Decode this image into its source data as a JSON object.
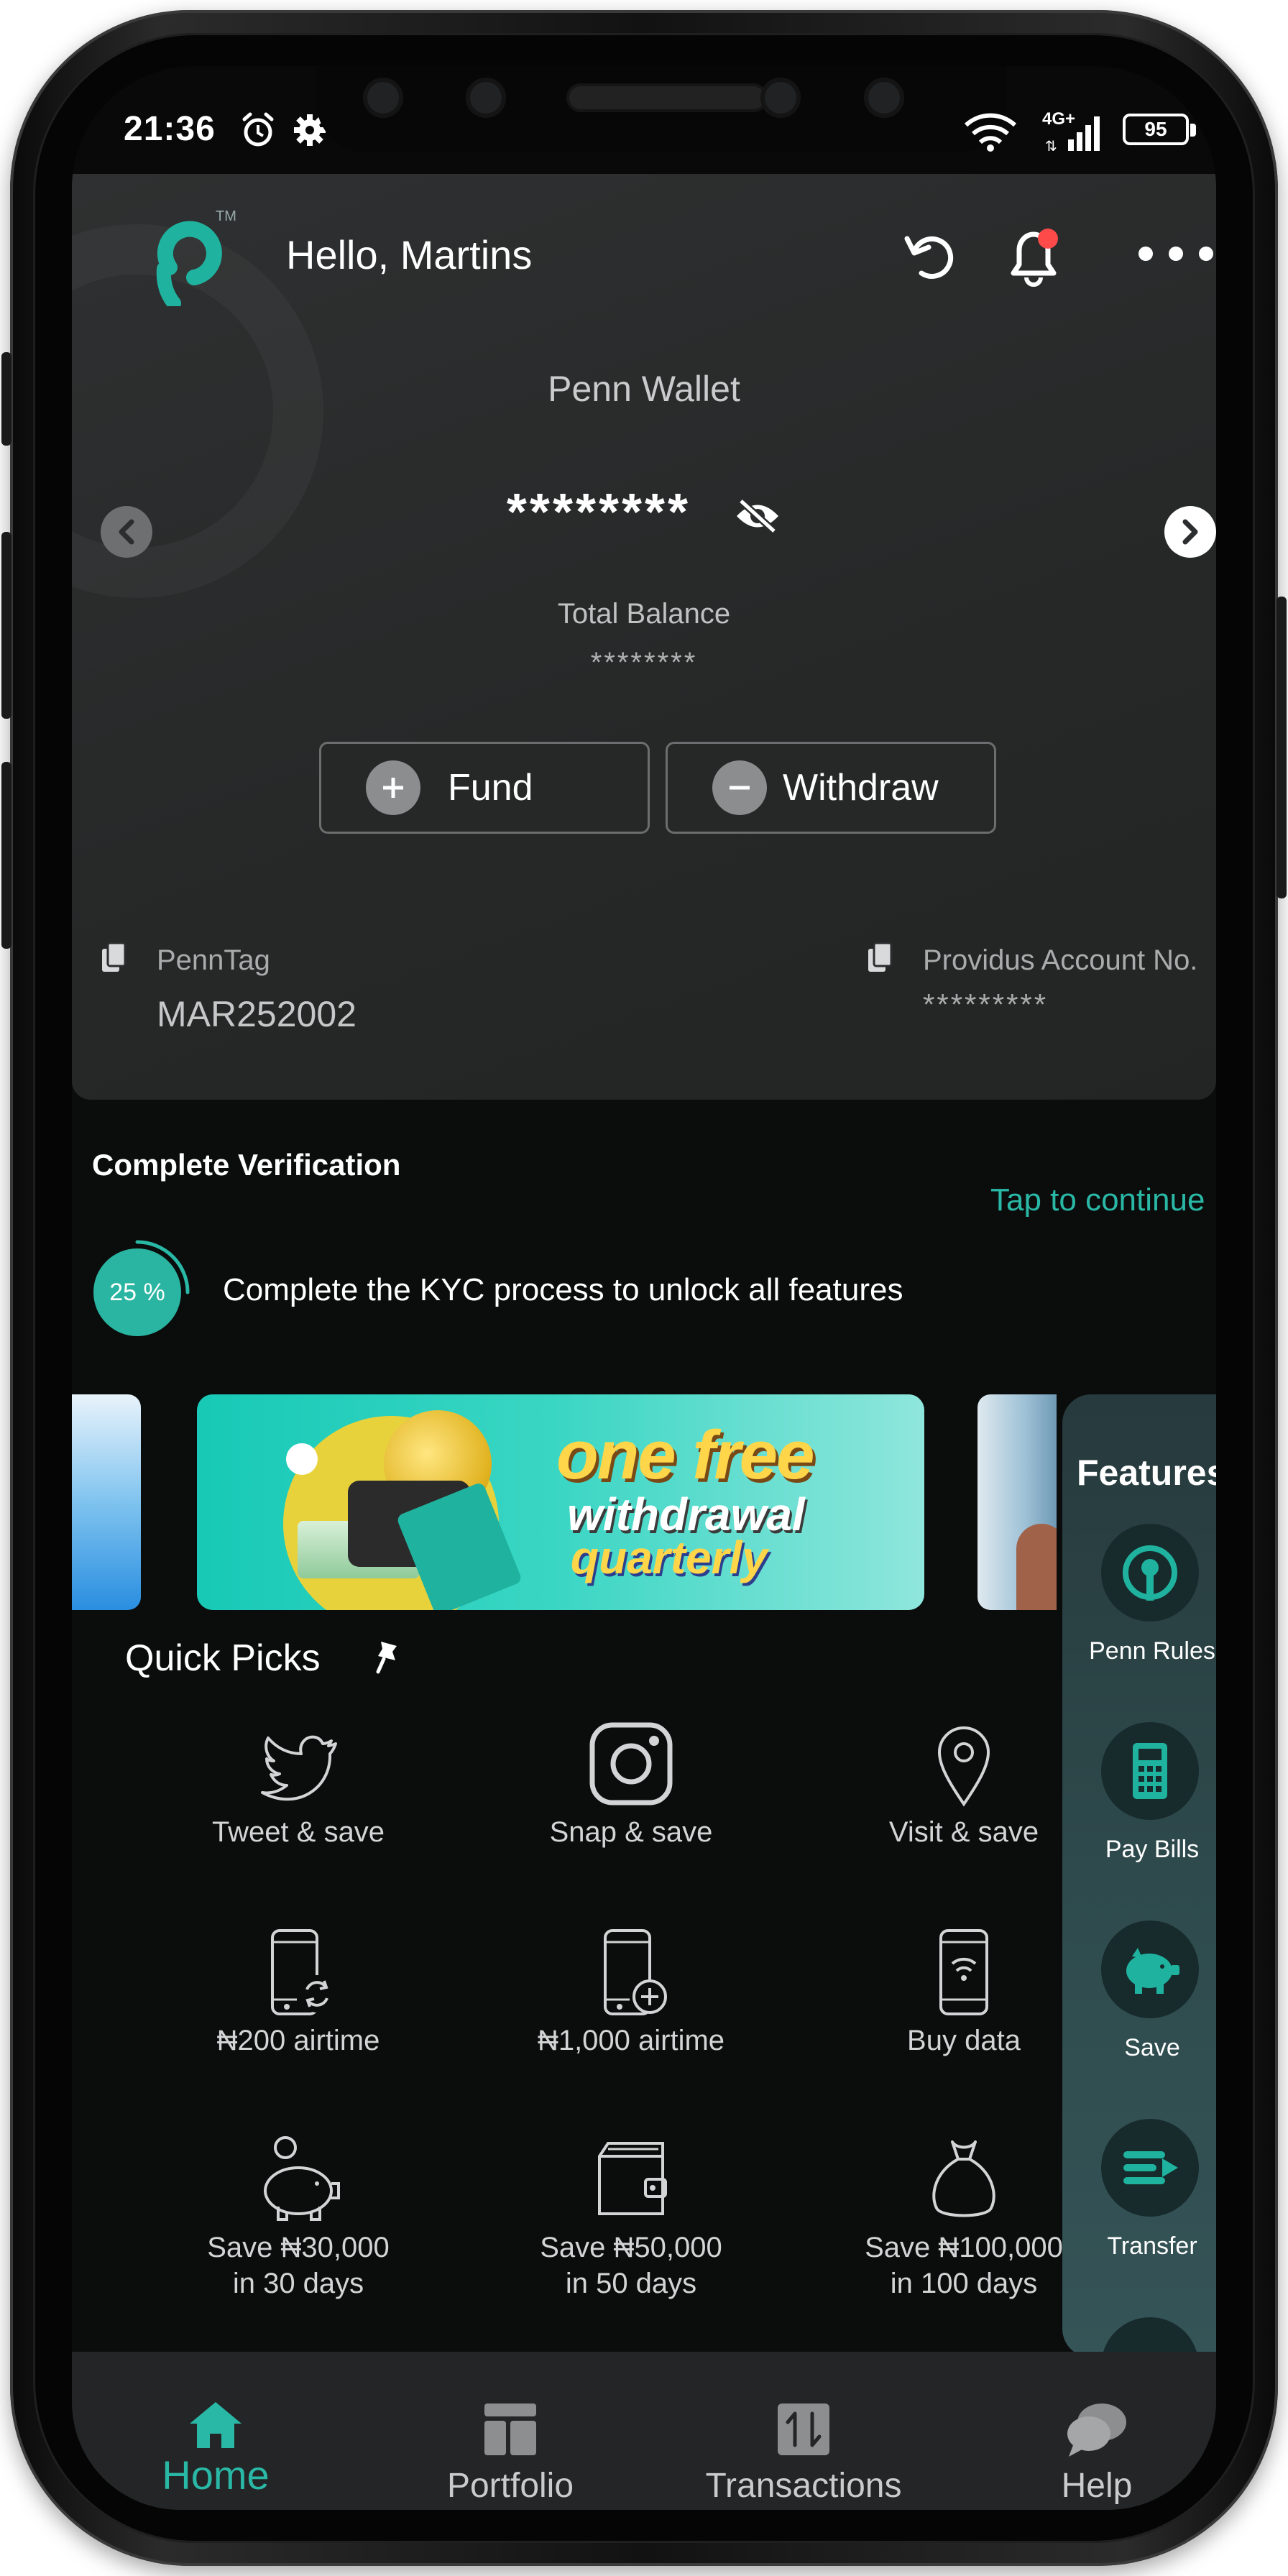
{
  "status_bar": {
    "time": "21:36",
    "network": "4G+",
    "battery": "95",
    "icons": [
      "alarm-icon",
      "settings-icon",
      "wifi-icon",
      "signal-icon",
      "battery-icon"
    ]
  },
  "header": {
    "greeting": "Hello, Martins",
    "logo_mark": "TM",
    "icons": [
      "penn-logo-icon",
      "refresh-icon",
      "bell-icon",
      "more-icon"
    ]
  },
  "wallet": {
    "name": "Penn Wallet",
    "balance_masked": "********",
    "total_label": "Total Balance",
    "total_masked": "********",
    "fund_label": "Fund",
    "withdraw_label": "Withdraw",
    "penntag_label": "PennTag",
    "penntag_value": "MAR252002",
    "account_label": "Providus Account No.",
    "account_masked": "*********"
  },
  "verification": {
    "title": "Complete Verification",
    "tap_label": "Tap to continue",
    "progress_text": "25 %",
    "progress_fraction": 0.25,
    "message": "Complete the KYC process to unlock all features"
  },
  "banner": {
    "line1": "one free",
    "line2": "withdrawal",
    "line3": "quarterly"
  },
  "features": {
    "title": "Features",
    "items": [
      {
        "label": "Penn Rules",
        "icon": "penn-rules-icon"
      },
      {
        "label": "Pay Bills",
        "icon": "pay-bills-icon"
      },
      {
        "label": "Save",
        "icon": "piggy-bank-icon"
      },
      {
        "label": "Transfer",
        "icon": "transfer-icon"
      }
    ]
  },
  "quick_picks": {
    "title": "Quick Picks",
    "items": [
      {
        "label": "Tweet & save",
        "icon": "twitter-icon"
      },
      {
        "label": "Snap & save",
        "icon": "instagram-icon"
      },
      {
        "label": "Visit & save",
        "icon": "location-pin-icon"
      },
      {
        "label": "₦200 airtime",
        "icon": "phone-refresh-icon"
      },
      {
        "label": "₦1,000 airtime",
        "icon": "phone-add-icon"
      },
      {
        "label": "Buy data",
        "icon": "phone-wifi-icon"
      },
      {
        "label": "Save ₦30,000",
        "label2": "in 30 days",
        "icon": "piggy-bank-outline-icon"
      },
      {
        "label": "Save ₦50,000",
        "label2": "in 50 days",
        "icon": "wallet-icon"
      },
      {
        "label": "Save ₦100,000",
        "label2": "in 100 days",
        "icon": "money-bag-icon"
      }
    ]
  },
  "bottom_nav": {
    "items": [
      {
        "label": "Home",
        "icon": "home-icon",
        "active": true
      },
      {
        "label": "Portfolio",
        "icon": "portfolio-icon",
        "active": false
      },
      {
        "label": "Transactions",
        "icon": "transactions-icon",
        "active": false
      },
      {
        "label": "Help",
        "icon": "chat-bubbles-icon",
        "active": false
      }
    ]
  },
  "colors": {
    "accent": "#2ab8a6",
    "card_bg": "#2a2c2d",
    "screen_bg": "#0b0c0c",
    "notification_dot": "#ff4a4a"
  }
}
